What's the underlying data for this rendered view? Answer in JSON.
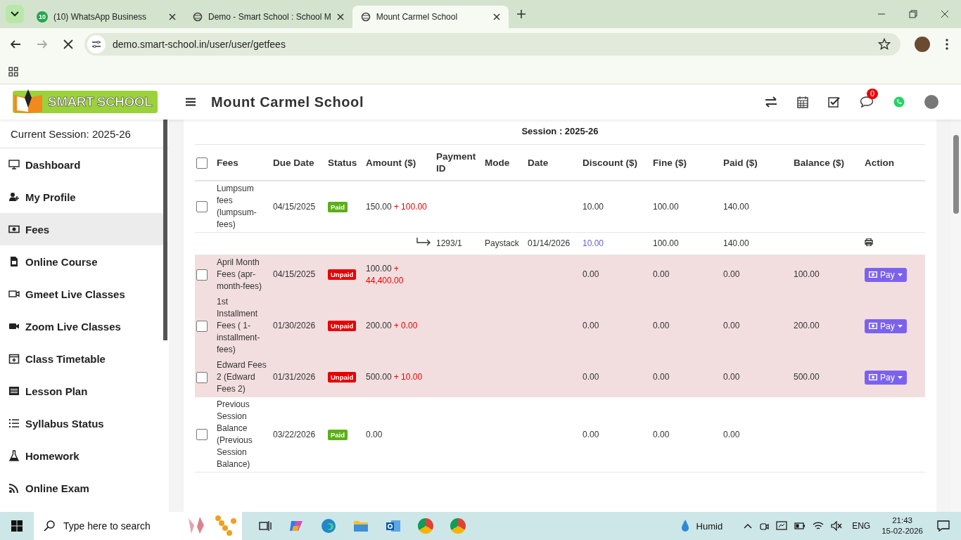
{
  "browser": {
    "tabs": [
      {
        "title": "(10) WhatsApp Business",
        "badge": "10",
        "kind": "whatsapp",
        "selected": false
      },
      {
        "title": "Demo - Smart School : School M",
        "kind": "site",
        "selected": false
      },
      {
        "title": "Mount Carmel School",
        "kind": "site",
        "selected": true
      }
    ],
    "url": "demo.smart-school.in/user/user/getfees"
  },
  "header": {
    "logo_text": "SMART SCHOOL",
    "school_name": "Mount Carmel School",
    "notification_count": "0"
  },
  "sidebar": {
    "session": "Current Session: 2025-26",
    "items": [
      {
        "label": "Dashboard",
        "selected": false
      },
      {
        "label": "My Profile",
        "selected": false
      },
      {
        "label": "Fees",
        "selected": true
      },
      {
        "label": "Online Course",
        "selected": false
      },
      {
        "label": "Gmeet Live Classes",
        "selected": false
      },
      {
        "label": "Zoom Live Classes",
        "selected": false
      },
      {
        "label": "Class Timetable",
        "selected": false
      },
      {
        "label": "Lesson Plan",
        "selected": false
      },
      {
        "label": "Syllabus Status",
        "selected": false
      },
      {
        "label": "Homework",
        "selected": false
      },
      {
        "label": "Online Exam",
        "selected": false
      }
    ]
  },
  "content": {
    "session_heading": "Session : 2025-26",
    "table": {
      "select_all_checked": false,
      "columns": [
        "Fees",
        "Due Date",
        "Status",
        "Amount ($)",
        "Payment ID",
        "Mode",
        "Date",
        "Discount ($)",
        "Fine ($)",
        "Paid ($)",
        "Balance ($)",
        "Action"
      ],
      "rows": [
        {
          "kind": "fee",
          "checked": false,
          "fees": "Lumpsum fees (lumpsum-fees)",
          "due_date": "04/15/2025",
          "status": {
            "label": "Paid",
            "kind": "paid"
          },
          "amount": "150.00",
          "fine_added": "+ 100.00",
          "discount": "10.00",
          "fine": "100.00",
          "paid": "140.00"
        },
        {
          "kind": "payment",
          "payment_id": "1293/1",
          "mode": "Paystack",
          "date": "01/14/2026",
          "discount": "10.00",
          "fine": "100.00",
          "paid": "140.00"
        },
        {
          "kind": "fee",
          "checked": false,
          "fees": "April Month Fees (apr-month-fees)",
          "due_date": "04/15/2025",
          "status": {
            "label": "Unpaid",
            "kind": "unpaid"
          },
          "amount": "100.00",
          "fine_added": "+ 44,400.00",
          "discount": "0.00",
          "fine": "0.00",
          "paid": "0.00",
          "balance": "100.00",
          "action": "Pay"
        },
        {
          "kind": "fee",
          "checked": false,
          "fees": "1st Installment Fees ( 1-installment-fees)",
          "due_date": "01/30/2026",
          "status": {
            "label": "Unpaid",
            "kind": "unpaid"
          },
          "amount": "200.00",
          "fine_added": "+ 0.00",
          "discount": "0.00",
          "fine": "0.00",
          "paid": "0.00",
          "balance": "200.00",
          "action": "Pay"
        },
        {
          "kind": "fee",
          "checked": false,
          "fees": "Edward Fees 2 (Edward Fees 2)",
          "due_date": "01/31/2026",
          "status": {
            "label": "Unpaid",
            "kind": "unpaid"
          },
          "amount": "500.00",
          "fine_added": "+ 10.00",
          "discount": "0.00",
          "fine": "0.00",
          "paid": "0.00",
          "balance": "500.00",
          "action": "Pay"
        },
        {
          "kind": "fee",
          "checked": false,
          "fees": "Previous Session Balance (Previous Session Balance)",
          "due_date": "03/22/2026",
          "status": {
            "label": "Paid",
            "kind": "paid"
          },
          "amount": "0.00",
          "discount": "0.00",
          "fine": "0.00",
          "paid": "0.00"
        }
      ]
    }
  },
  "taskbar": {
    "search_placeholder": "Type here to search",
    "weather": "Humid",
    "language": "ENG",
    "time": "21:43",
    "date": "15-02-2026"
  }
}
